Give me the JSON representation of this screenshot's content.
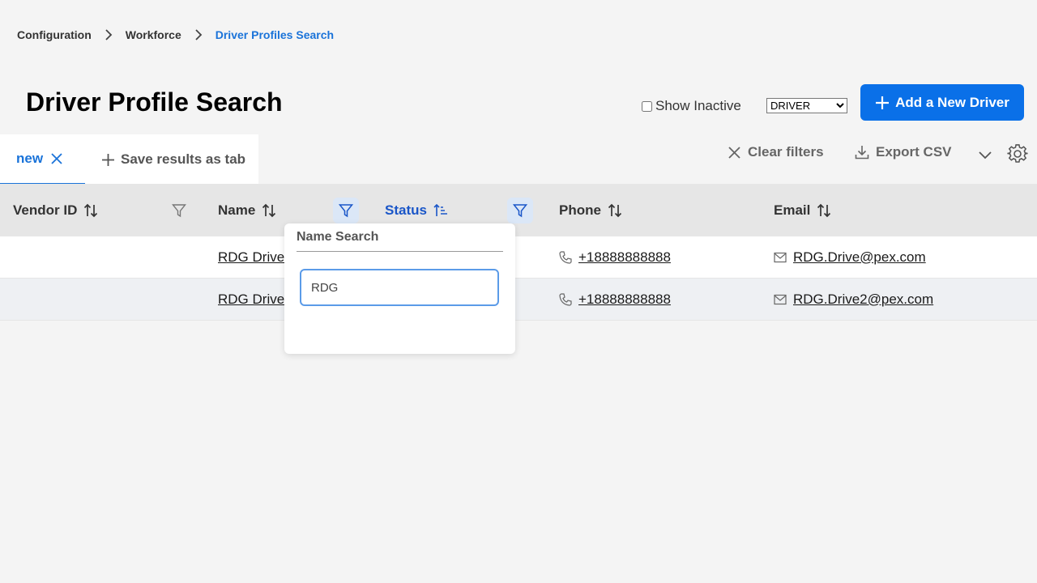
{
  "breadcrumb": {
    "items": [
      "Configuration",
      "Workforce",
      "Driver Profiles Search"
    ]
  },
  "page": {
    "title": "Driver Profile Search"
  },
  "header_controls": {
    "show_inactive_label": "Show Inactive",
    "show_inactive_checked": false,
    "role_selected": "DRIVER",
    "add_button_label": "Add a New Driver"
  },
  "tabs": {
    "active_label": "new",
    "save_label": "Save results as tab"
  },
  "toolbar": {
    "clear_filters_label": "Clear filters",
    "export_label": "Export CSV"
  },
  "table": {
    "columns": [
      "Vendor ID",
      "Name",
      "Status",
      "Phone",
      "Email"
    ],
    "rows": [
      {
        "vendor_id": "",
        "name": "RDG Drive",
        "phone": "+18888888888",
        "email": "RDG.Drive@pex.com"
      },
      {
        "vendor_id": "",
        "name": "RDG Drive2",
        "phone": "+18888888888",
        "email": "RDG.Drive2@pex.com"
      }
    ]
  },
  "name_filter_popover": {
    "title": "Name Search",
    "value": "RDG"
  },
  "colors": {
    "primary": "#0a70e8",
    "link_active": "#1a73d9",
    "header_bg": "#e6e6e6"
  }
}
